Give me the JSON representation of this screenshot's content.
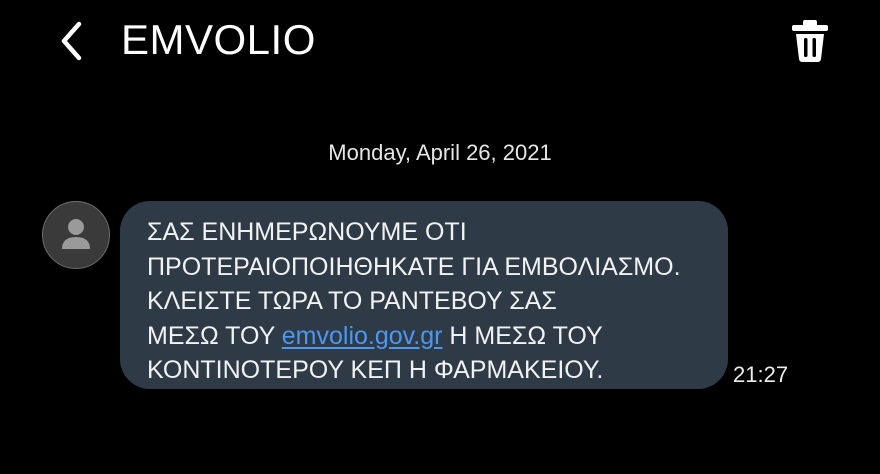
{
  "header": {
    "title": "EMVOLIO",
    "back_icon": "chevron-left-icon",
    "delete_icon": "trash-icon"
  },
  "conversation": {
    "date": "Monday, April 26, 2021",
    "avatar_icon": "person-icon",
    "message": {
      "line1": "ΣΑΣ ΕΝΗΜΕΡΩΝΟΥΜΕ ΟΤΙ",
      "line2": "ΠΡΟΤΕΡΑΙΟΠΟΙΗΘΗΚΑΤΕ ΓΙΑ ΕΜΒΟΛΙΑΣΜΟ.",
      "line3": "ΚΛΕΙΣΤΕ ΤΩΡΑ ΤΟ ΡΑΝΤΕΒΟΥ ΣΑΣ",
      "line4_before": "ΜΕΣΩ ΤΟΥ ",
      "link": "emvolio.gov.gr",
      "line4_after": " Η ΜΕΣΩ ΤΟΥ",
      "line5": "ΚΟΝΤΙΝΟΤΕΡΟΥ ΚΕΠ Η ΦΑΡΜΑΚΕΙΟΥ."
    },
    "time": "21:27"
  },
  "colors": {
    "background": "#000000",
    "bubble": "#2e3b47",
    "link": "#4c97f0",
    "text": "#ffffff"
  }
}
